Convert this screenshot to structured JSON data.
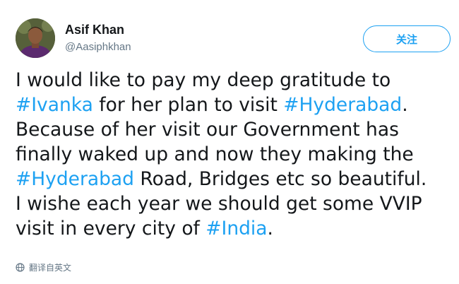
{
  "user": {
    "name": "Asif Khan",
    "handle": "@Aasiphkhan"
  },
  "follow_label": "关注",
  "tweet": {
    "lines": [
      [
        {
          "text": "I would like to pay my deep gratitude to"
        }
      ],
      [
        {
          "text": "#Ivanka",
          "hashtag": true
        },
        {
          "text": " for her plan to visit "
        },
        {
          "text": "#Hyderabad",
          "hashtag": true
        },
        {
          "text": "."
        }
      ],
      [
        {
          "text": "Because of her visit our Government has"
        }
      ],
      [
        {
          "text": "finally waked up and now they making the"
        }
      ],
      [
        {
          "text": "#Hyderabad",
          "hashtag": true
        },
        {
          "text": " Road, Bridges etc so beautiful."
        }
      ],
      [
        {
          "text": "I wishe each year we should get some VVIP"
        }
      ],
      [
        {
          "text": "visit in every city of "
        },
        {
          "text": "#India",
          "hashtag": true
        },
        {
          "text": "."
        }
      ]
    ]
  },
  "translate_label": "翻译自英文",
  "colors": {
    "accent": "#1da1f2",
    "text": "#14171a",
    "secondary": "#657786"
  },
  "icons": {
    "translate": "globe-icon"
  }
}
